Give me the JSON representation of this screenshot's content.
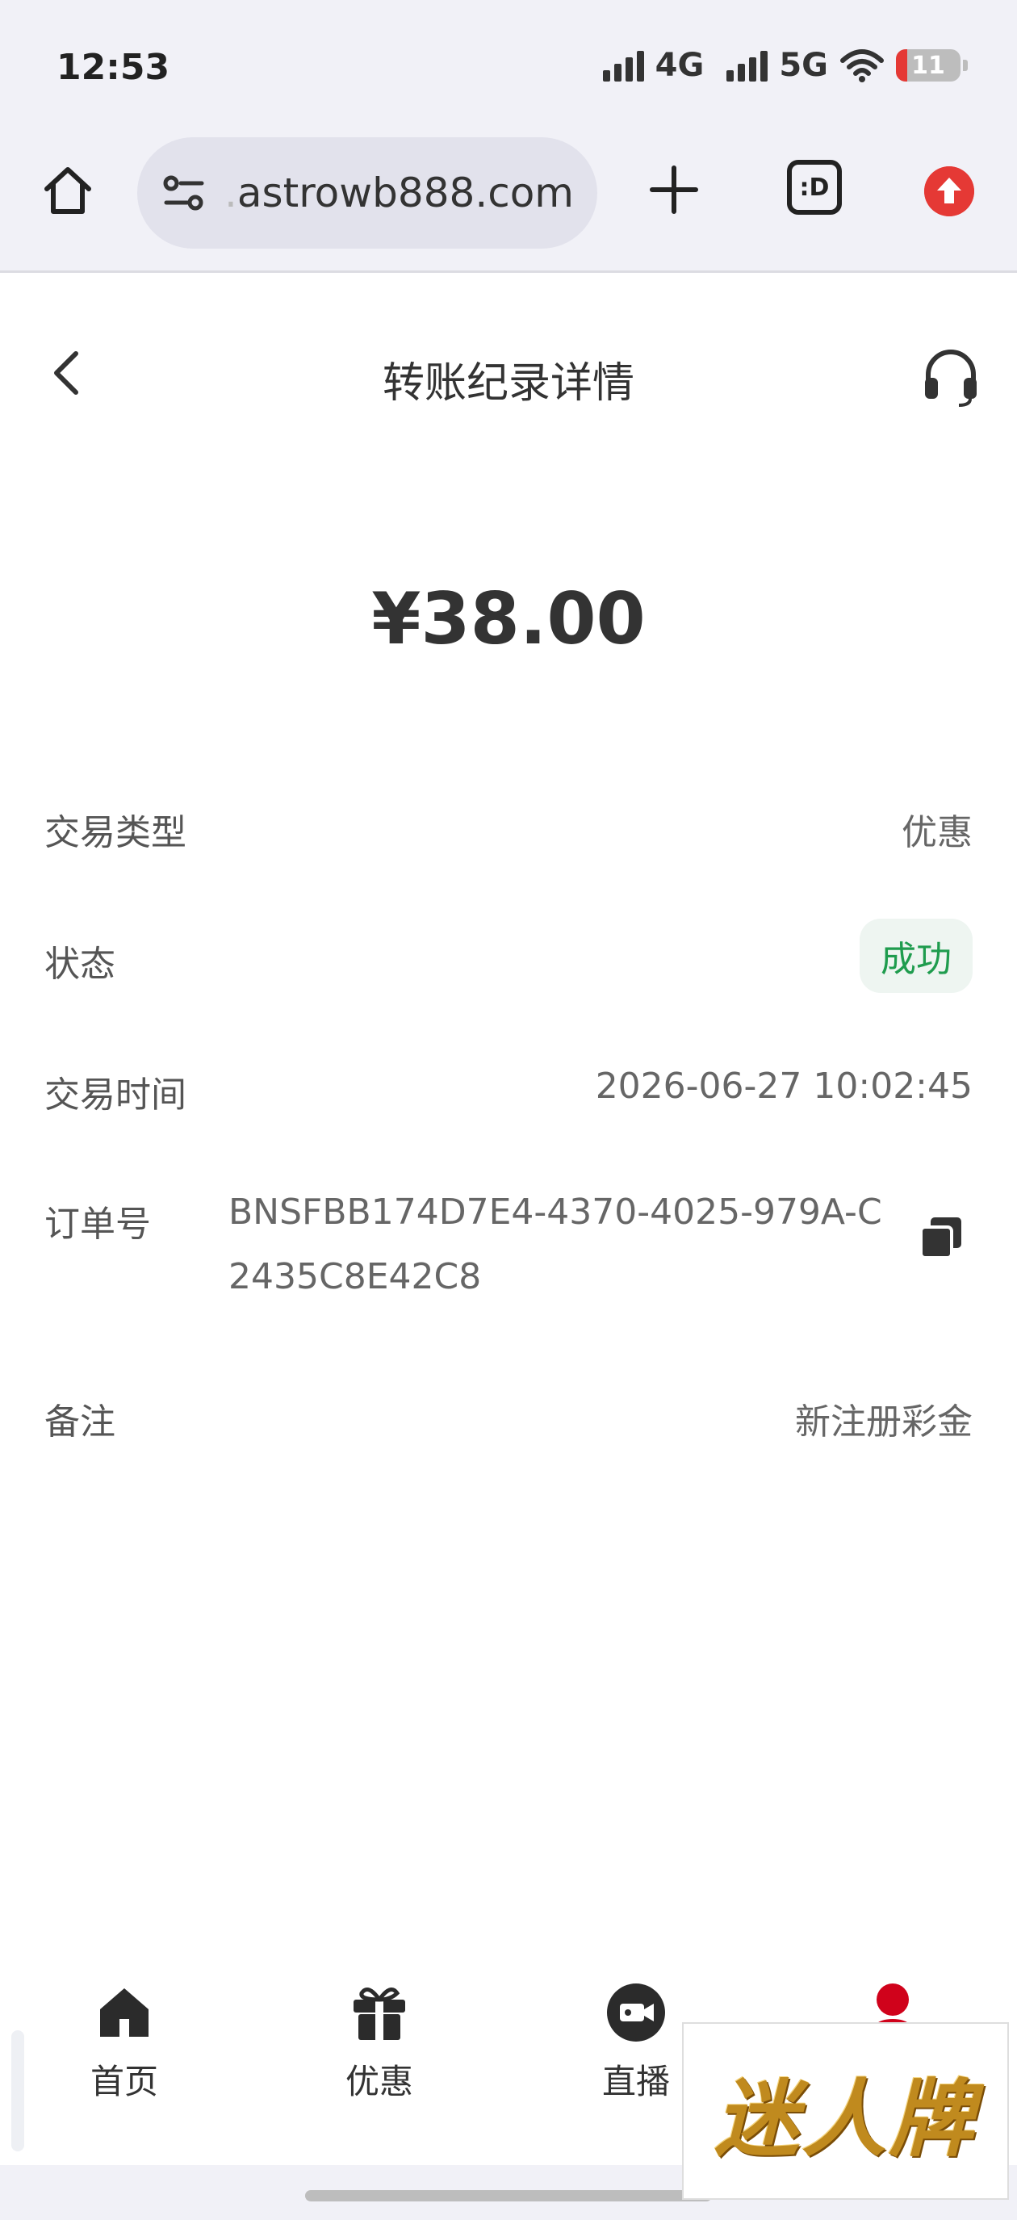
{
  "status_bar": {
    "time": "12:53",
    "network1": "4G",
    "network2": "5G",
    "battery": "11"
  },
  "browser": {
    "url": "astrowb888.com",
    "url_prefix": ".",
    "tab_icon_text": ":D"
  },
  "header": {
    "title": "转账纪录详情"
  },
  "amount": "¥38.00",
  "details": {
    "type_label": "交易类型",
    "type_value": "优惠",
    "status_label": "状态",
    "status_value": "成功",
    "time_label": "交易时间",
    "time_value": "2026-06-27 10:02:45",
    "order_label": "订单号",
    "order_value": "BNSFBB174D7E4-4370-4025-979A-C2435C8E42C8",
    "remark_label": "备注",
    "remark_value": "新注册彩金"
  },
  "nav": {
    "items": [
      {
        "label": "首页"
      },
      {
        "label": "优惠"
      },
      {
        "label": "直播"
      }
    ]
  },
  "watermark": "迷人牌",
  "colors": {
    "accent_red": "#e53935",
    "success_green": "#1f9c4e",
    "watermark_gold": "#c08a1e"
  }
}
